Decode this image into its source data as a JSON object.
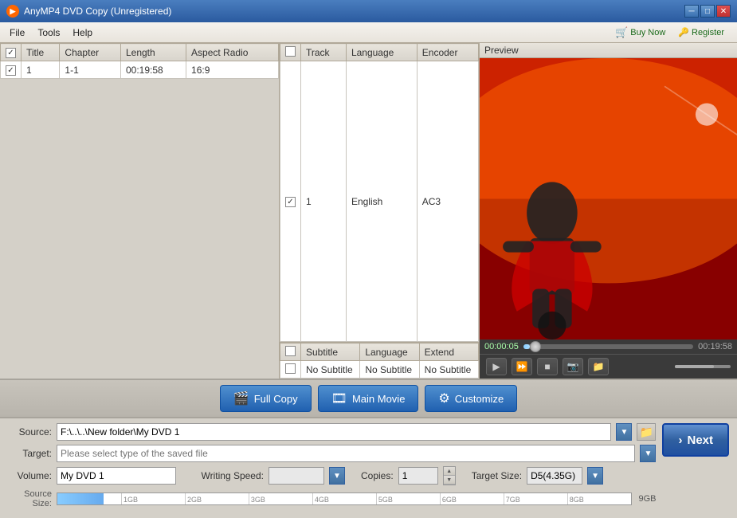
{
  "titlebar": {
    "title": "AnyMP4 DVD Copy (Unregistered)",
    "min_label": "─",
    "max_label": "□",
    "close_label": "✕"
  },
  "menubar": {
    "items": [
      {
        "id": "file",
        "label": "File"
      },
      {
        "id": "tools",
        "label": "Tools"
      },
      {
        "id": "help",
        "label": "Help"
      }
    ],
    "buy_label": "Buy Now",
    "register_label": "Register"
  },
  "main_table": {
    "columns": [
      {
        "id": "check",
        "label": ""
      },
      {
        "id": "title",
        "label": "Title"
      },
      {
        "id": "chapter",
        "label": "Chapter"
      },
      {
        "id": "length",
        "label": "Length"
      },
      {
        "id": "aspect",
        "label": "Aspect Radio"
      }
    ],
    "rows": [
      {
        "check": true,
        "title": "1",
        "chapter": "1-1",
        "length": "00:19:58",
        "aspect": "16:9"
      }
    ]
  },
  "track_table": {
    "columns": [
      {
        "id": "check",
        "label": ""
      },
      {
        "id": "track",
        "label": "Track"
      },
      {
        "id": "language",
        "label": "Language"
      },
      {
        "id": "encoder",
        "label": "Encoder"
      }
    ],
    "rows": [
      {
        "check": true,
        "track": "1",
        "language": "English",
        "encoder": "AC3"
      }
    ]
  },
  "subtitle_table": {
    "columns": [
      {
        "id": "check",
        "label": ""
      },
      {
        "id": "subtitle",
        "label": "Subtitle"
      },
      {
        "id": "language",
        "label": "Language"
      },
      {
        "id": "extend",
        "label": "Extend"
      }
    ],
    "rows": [
      {
        "check": false,
        "subtitle": "No Subtitle",
        "language": "No Subtitle",
        "extend": "No Subtitle"
      }
    ]
  },
  "preview": {
    "label": "Preview"
  },
  "player": {
    "time_start": "00:00:05",
    "time_end": "00:19:58",
    "seek_percent": 4
  },
  "action_buttons": [
    {
      "id": "full-copy",
      "label": "Full Copy"
    },
    {
      "id": "main-movie",
      "label": "Main Movie"
    },
    {
      "id": "customize",
      "label": "Customize"
    }
  ],
  "bottom": {
    "source_label": "Source:",
    "source_value": "F:\\..\\..\\New folder\\My DVD 1",
    "source_placeholder": "F:\\..\\..\\New folder\\My DVD 1",
    "target_label": "Target:",
    "target_placeholder": "Please select type of the saved file",
    "volume_label": "Volume:",
    "volume_value": "My DVD 1",
    "writing_speed_label": "Writing Speed:",
    "writing_speed_value": "",
    "copies_label": "Copies:",
    "copies_value": "1",
    "target_size_label": "Target Size:",
    "target_size_value": "D5(4.35G)",
    "source_size_label": "Source Size:",
    "size_ticks": [
      "1GB",
      "2GB",
      "3GB",
      "4GB",
      "5GB",
      "6GB",
      "7GB",
      "8GB",
      "9GB"
    ],
    "next_label": "Next"
  }
}
